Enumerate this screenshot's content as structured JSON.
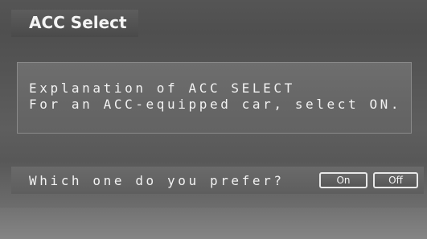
{
  "screen": {
    "title": "ACC Select",
    "explanation": {
      "line1": "Explanation of ACC SELECT",
      "line2": "For an ACC-equipped car, select ON."
    },
    "question": "Which one do you prefer?",
    "buttons": {
      "on_label": "On",
      "off_label": "Off"
    }
  }
}
